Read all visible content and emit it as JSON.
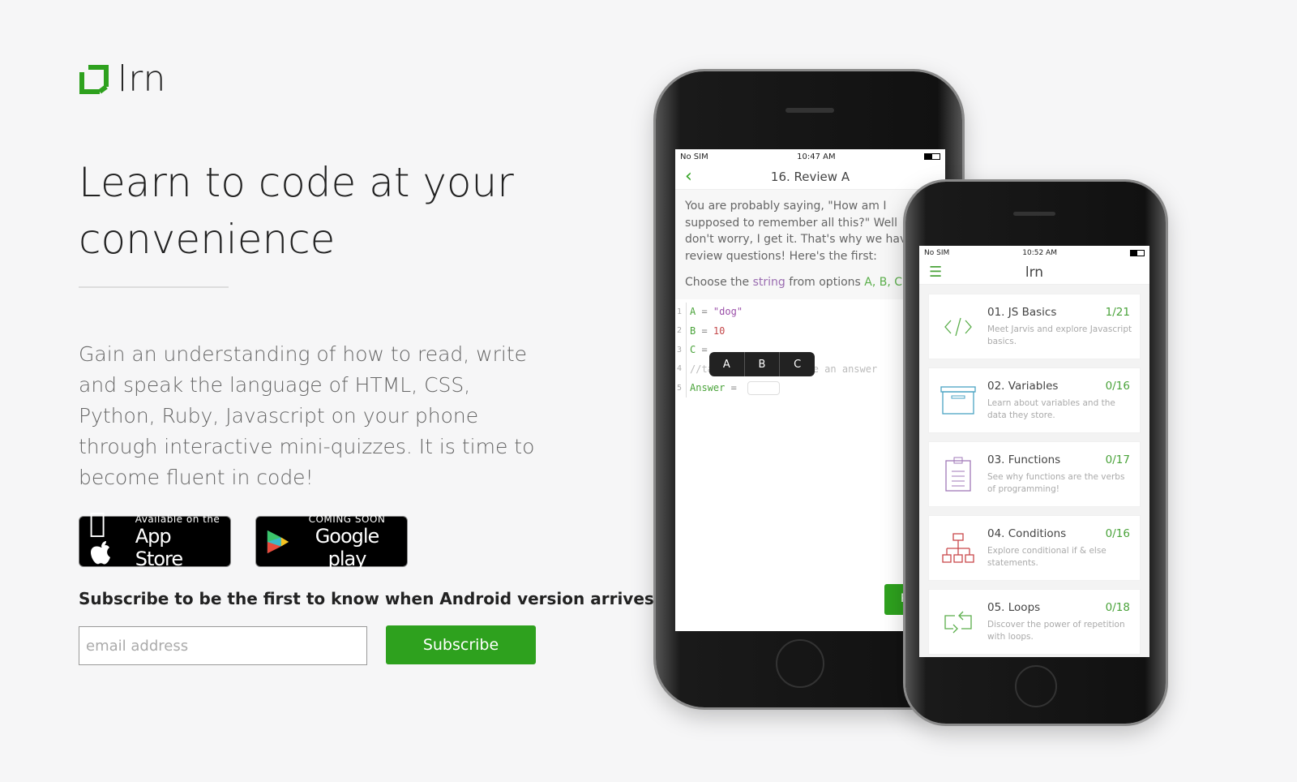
{
  "brand": {
    "name": "lrn",
    "accent": "#2ea11e"
  },
  "hero": {
    "title": "Learn to code at your convenience",
    "description": "Gain an understanding of how to read, write and speak the language of HTML, CSS, Python, Ruby, Javascript on your phone through interactive mini-quizzes. It is time to become fluent in code!"
  },
  "stores": {
    "apple": {
      "small": "Available on the",
      "big": "App Store"
    },
    "google": {
      "small": "COMING SOON",
      "big": "Google play"
    }
  },
  "subscribe": {
    "text": "Subscribe to be the first to know when Android version arrives",
    "placeholder": "email address",
    "button": "Subscribe"
  },
  "phone1": {
    "carrier": "No SIM",
    "time": "10:47 AM",
    "title": "16. Review A",
    "intro": "You are probably saying, \"How am I supposed to remember all this?\" Well don't worry, I get it. That's why we have review questions! Here's the first:",
    "prompt_pre": "Choose the ",
    "prompt_kw": "string",
    "prompt_mid": " from options ",
    "prompt_opts": "A, B, C.",
    "code": [
      {
        "n": "1",
        "var": "A",
        "op": " = ",
        "val": "\"dog\""
      },
      {
        "n": "2",
        "var": "B",
        "op": " = ",
        "val": "10"
      },
      {
        "n": "3",
        "var": "C",
        "op": " = ",
        "val": ""
      },
      {
        "n": "4",
        "comment": "//tap below and choose an answer"
      },
      {
        "n": "5",
        "var": "Answer",
        "op": " = ",
        "val": ""
      }
    ],
    "popup": [
      "A",
      "B",
      "C"
    ],
    "button_partial": "R"
  },
  "phone2": {
    "carrier": "No SIM",
    "time": "10:52 AM",
    "title": "lrn",
    "lessons": [
      {
        "title": "01. JS Basics",
        "progress": "1/21",
        "desc": "Meet Jarvis and explore Javascript basics.",
        "icon": "code-icon",
        "color": "#5aae4a"
      },
      {
        "title": "02. Variables",
        "progress": "0/16",
        "desc": "Learn about variables and the data they store.",
        "icon": "box-icon",
        "color": "#4aa3c4"
      },
      {
        "title": "03. Functions",
        "progress": "0/17",
        "desc": "See why functions are the verbs of programming!",
        "icon": "clipboard-icon",
        "color": "#a07ab8"
      },
      {
        "title": "04. Conditions",
        "progress": "0/16",
        "desc": "Explore conditional if & else statements.",
        "icon": "flowchart-icon",
        "color": "#c9474a"
      },
      {
        "title": "05. Loops",
        "progress": "0/18",
        "desc": "Discover the power of repetition with loops.",
        "icon": "loop-icon",
        "color": "#5aae4a"
      }
    ]
  }
}
